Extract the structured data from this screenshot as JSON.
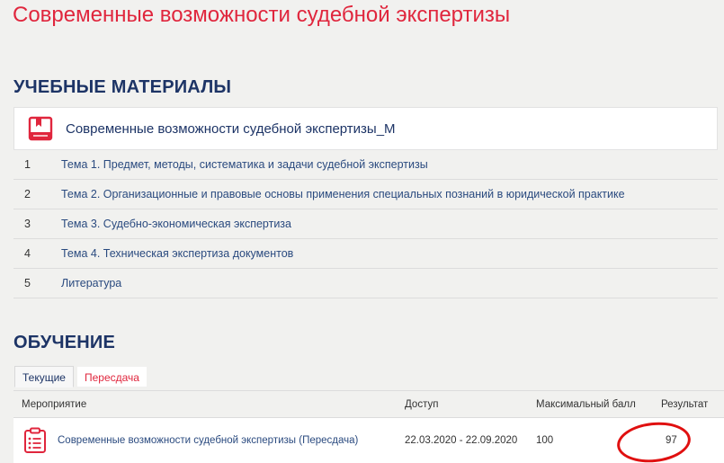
{
  "page": {
    "title": "Современные возможности судебной экспертизы"
  },
  "materials": {
    "heading": "УЧЕБНЫЕ МАТЕРИАЛЫ",
    "card_title": "Современные возможности судебной экспертизы_М",
    "items": [
      {
        "num": "1",
        "label": "Тема 1. Предмет, методы, систематика и задачи судебной экспертизы"
      },
      {
        "num": "2",
        "label": "Тема 2. Организационные и правовые основы применения специальных познаний в юридической практике"
      },
      {
        "num": "3",
        "label": "Тема 3. Судебно-экономическая экспертиза"
      },
      {
        "num": "4",
        "label": "Тема 4. Техническая экспертиза документов"
      },
      {
        "num": "5",
        "label": "Литература"
      }
    ]
  },
  "learning": {
    "heading": "ОБУЧЕНИЕ",
    "tabs": [
      "Текущие",
      "Пересдача"
    ],
    "columns": [
      "Мероприятие",
      "Доступ",
      "Максимальный балл",
      "Результат"
    ],
    "rows": [
      {
        "event": "Современные возможности судебной экспертизы (Пересдача)",
        "access": "22.03.2020 - 22.09.2020",
        "max_score": "100",
        "result": "97"
      }
    ]
  },
  "colors": {
    "accent_red": "#e0263d",
    "heading_navy": "#1d3466",
    "link_blue": "#2a4a7f",
    "annotation_red": "#e01010"
  },
  "icons": {
    "card": "book-icon",
    "task": "clipboard-list-icon"
  }
}
